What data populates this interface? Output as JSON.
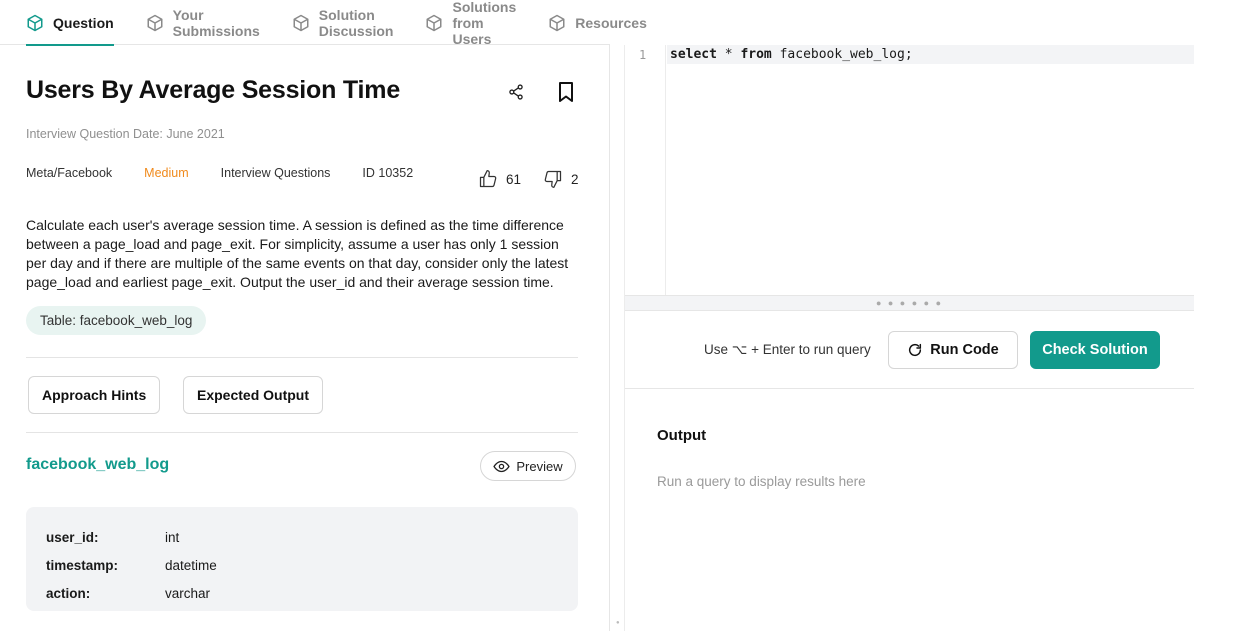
{
  "tabs": [
    {
      "label": "Question",
      "active": true
    },
    {
      "label": "Your Submissions",
      "active": false
    },
    {
      "label": "Solution Discussion",
      "active": false
    },
    {
      "label": "Solutions from Users",
      "active": false
    },
    {
      "label": "Resources",
      "active": false
    }
  ],
  "question": {
    "title": "Users By Average Session Time",
    "date": "Interview Question Date: June 2021",
    "company": "Meta/Facebook",
    "difficulty": "Medium",
    "category": "Interview Questions",
    "id": "ID 10352",
    "likes": "61",
    "dislikes": "2",
    "description": "Calculate each user's average session time. A session is defined as the time difference between a page_load and page_exit. For simplicity, assume a user has only 1 session per day and if there are multiple of the same events on that day, consider only the latest page_load and earliest page_exit. Output the user_id and their average session time.",
    "table_chip": "Table: facebook_web_log",
    "approach_hints_label": "Approach Hints",
    "expected_output_label": "Expected Output"
  },
  "schema": {
    "table_name": "facebook_web_log",
    "preview_label": "Preview",
    "columns": [
      {
        "name": "user_id:",
        "type": "int"
      },
      {
        "name": "timestamp:",
        "type": "datetime"
      },
      {
        "name": "action:",
        "type": "varchar"
      }
    ]
  },
  "editor": {
    "line_number": "1",
    "kw1": "select",
    "op": " * ",
    "kw2": "from",
    "rest": " facebook_web_log;"
  },
  "actions": {
    "hint": "Use ⌥ + Enter to run query",
    "run_label": "Run Code",
    "check_label": "Check Solution"
  },
  "output": {
    "title": "Output",
    "empty": "Run a query to display results here"
  },
  "colors": {
    "accent": "#129a8c",
    "difficulty": "#f08a1c"
  }
}
